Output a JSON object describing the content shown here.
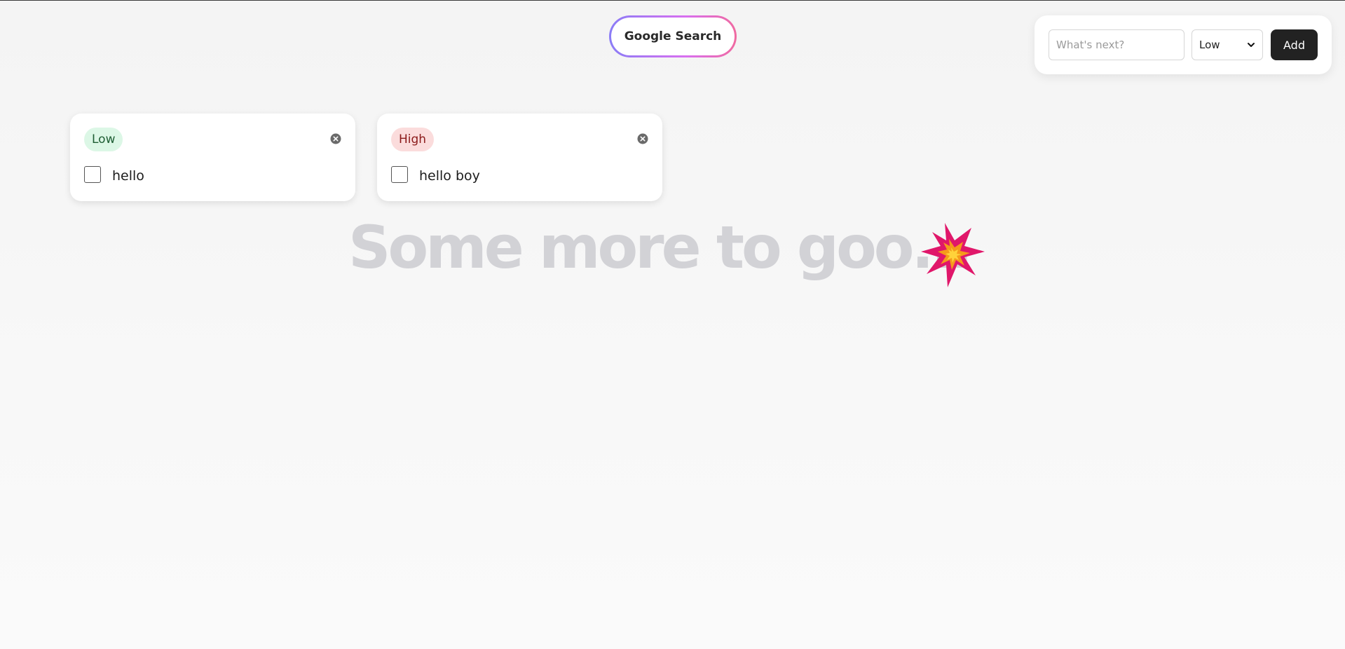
{
  "header": {
    "google_button_label": "Google Search"
  },
  "add_panel": {
    "input_placeholder": "What's next?",
    "input_value": "",
    "priority_selected": "Low",
    "add_label": "Add"
  },
  "cards": [
    {
      "priority": "Low",
      "task": "hello",
      "checked": false
    },
    {
      "priority": "High",
      "task": "hello boy",
      "checked": false
    }
  ],
  "empty_message": "Some more to goo...",
  "icons": {
    "decoration": "collision-burst-icon",
    "remove": "close-circle-icon",
    "dropdown": "chevron-down-icon"
  },
  "colors": {
    "low_badge_bg": "#dcf7e6",
    "low_badge_text": "#1f5e34",
    "high_badge_bg": "#fbdcdc",
    "high_badge_text": "#8b1a1a",
    "add_button_bg": "#222222",
    "gradient_start": "#8a7cf6",
    "gradient_end": "#f06aa0"
  }
}
